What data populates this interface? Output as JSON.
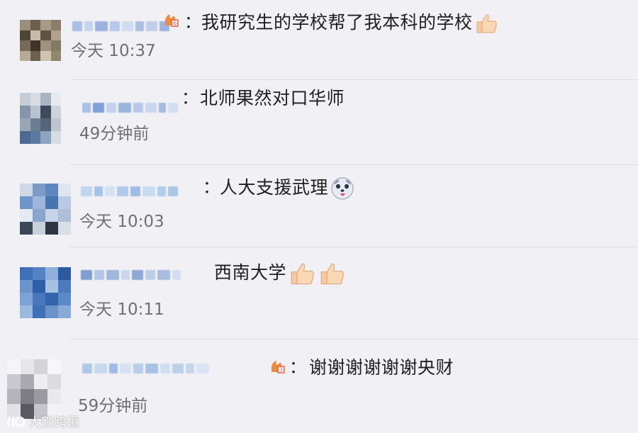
{
  "comments": [
    {
      "text": "我研究生的学校帮了我本科的学校",
      "time": "今天 10:37",
      "emojis": [
        "thumbs-up"
      ]
    },
    {
      "text": "北师果然对口华师",
      "time": "49分钟前",
      "emojis": []
    },
    {
      "text": "人大支援武理",
      "time": "今天 10:03",
      "emojis": [
        "doge"
      ]
    },
    {
      "text": "西南大学",
      "time": "今天 10:11",
      "emojis": [
        "thumbs-up",
        "thumbs-up"
      ]
    },
    {
      "text": "谢谢谢谢谢谢央财",
      "time": "59分钟前",
      "emojis": []
    }
  ],
  "colon": "：",
  "watermark": "大數跨境",
  "icons": {
    "level_badge": "level-badge-icon",
    "thumbs_up": "thumbs-up-emoji",
    "doge": "doge-emoji"
  },
  "colors": {
    "background": "#f1f1f5",
    "text": "#1f1f1f",
    "time": "#6f6f75",
    "level_badge": "#f08a3c"
  }
}
